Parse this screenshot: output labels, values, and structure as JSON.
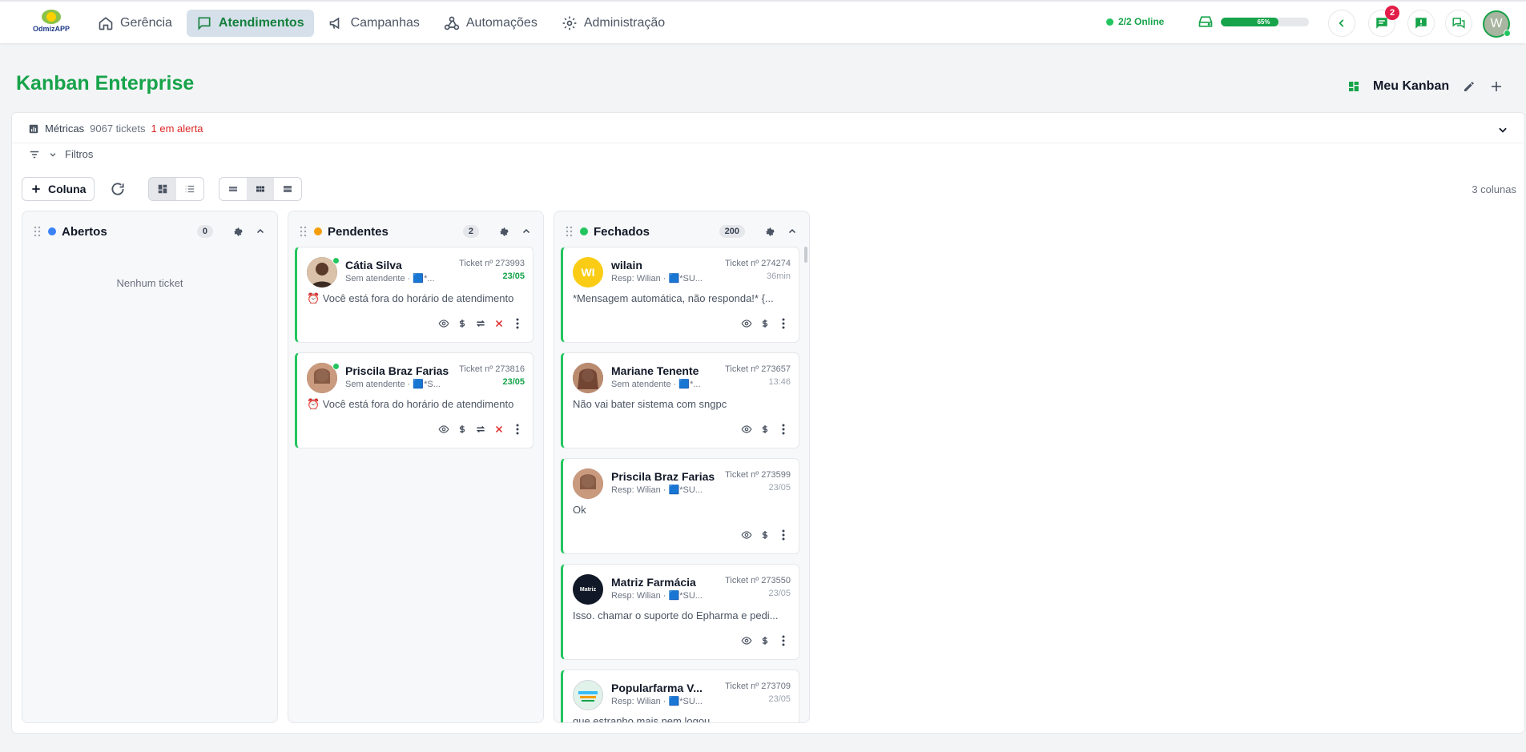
{
  "app": {
    "logo_text": "OdmizAPP"
  },
  "nav": [
    {
      "label": "Gerência",
      "icon": "home-icon",
      "active": false
    },
    {
      "label": "Atendimentos",
      "icon": "chat-icon",
      "active": true
    },
    {
      "label": "Campanhas",
      "icon": "megaphone-icon",
      "active": false
    },
    {
      "label": "Automações",
      "icon": "webhook-icon",
      "active": false
    },
    {
      "label": "Administração",
      "icon": "gear-icon",
      "active": false
    }
  ],
  "status": {
    "online": "2/2 Online",
    "storage_percent": 65,
    "storage_label": "65%"
  },
  "notifications": {
    "messages_count": "2"
  },
  "user": {
    "initial": "W"
  },
  "header": {
    "title": "Kanban Enterprise",
    "kanban_name": "Meu Kanban"
  },
  "metrics": {
    "label": "Métricas",
    "tickets": "9067 tickets",
    "alerts": "1 em alerta"
  },
  "filters": {
    "label": "Filtros"
  },
  "toolbar": {
    "add_column": "Coluna",
    "column_count": "3 colunas"
  },
  "columns": [
    {
      "name": "Abertos",
      "count": "0",
      "color": "#3b82f6",
      "empty_text": "Nenhum ticket",
      "cards": []
    },
    {
      "name": "Pendentes",
      "count": "2",
      "color": "#f59e0b",
      "cards": [
        {
          "name": "Cátia Silva",
          "sub": "Sem atendente · 🟦*...",
          "ticket": "Ticket nº 273993",
          "date": "23/05",
          "message": "⏰ Você está fora do horário de atendimento",
          "avatar_color": "#6b4f3f"
        },
        {
          "name": "Priscila Braz Farias",
          "sub": "Sem atendente · 🟦*S...",
          "ticket": "Ticket nº 273816",
          "date": "23/05",
          "message": "⏰ Você está fora do horário de atendimento",
          "avatar_color": "#8a5a44"
        }
      ]
    },
    {
      "name": "Fechados",
      "count": "200",
      "color": "#22c55e",
      "cards": [
        {
          "name": "wilain",
          "sub": "Resp: Wilian · 🟦*SU...",
          "ticket": "Ticket nº 274274",
          "date": "36min",
          "message": "*Mensagem automática, não responda!* {...",
          "avatar_text": "WI",
          "avatar_color": "#facc15"
        },
        {
          "name": "Mariane Tenente",
          "sub": "Sem atendente · 🟦*...",
          "ticket": "Ticket nº 273657",
          "date": "13:46",
          "message": "Não vai bater sistema com sngpc",
          "avatar_color": "#7c4a3a"
        },
        {
          "name": "Priscila Braz Farias",
          "sub": "Resp: Wilian · 🟦*SU...",
          "ticket": "Ticket nº 273599",
          "date": "23/05",
          "message": "Ok",
          "avatar_color": "#8a5a44"
        },
        {
          "name": "Matriz Farmácia",
          "sub": "Resp: Wilian · 🟦*SU...",
          "ticket": "Ticket nº 273550",
          "date": "23/05",
          "message": "Isso. chamar o suporte do Epharma e pedi...",
          "avatar_text": "Matriz",
          "avatar_color": "#111827"
        },
        {
          "name": "Popularfarma V...",
          "sub": "Resp: Wilian · 🟦*SU...",
          "ticket": "Ticket nº 273709",
          "date": "23/05",
          "message": "que estranho mais nem logou",
          "avatar_color": "#e0f2e9"
        }
      ]
    }
  ]
}
